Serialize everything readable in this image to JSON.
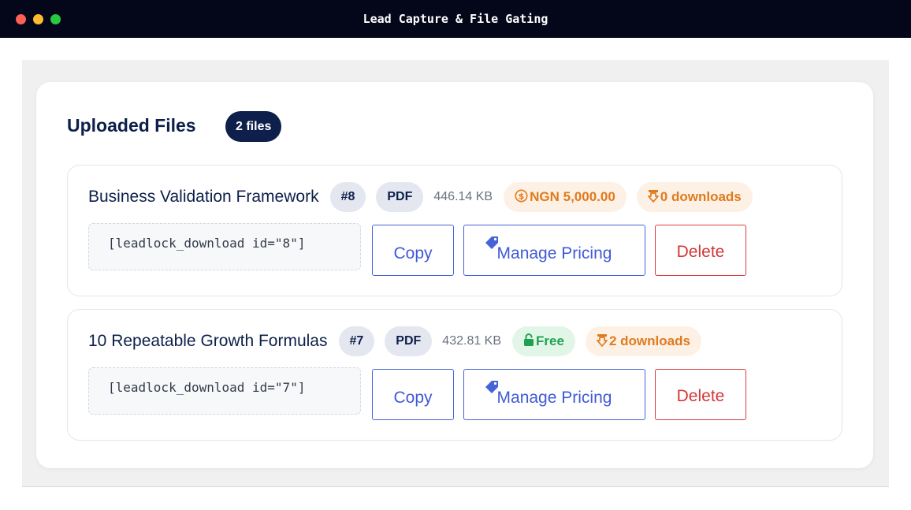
{
  "window": {
    "title": "Lead Capture & File Gating"
  },
  "panel": {
    "title": "Uploaded Files",
    "count_badge": "2 files"
  },
  "files": [
    {
      "name": "Business Validation Framework",
      "id_badge": "#8",
      "type": "PDF",
      "size": "446.14 KB",
      "price": "NGN 5,000.00",
      "downloads": "0 downloads",
      "shortcode": "[leadlock_download id=\"8\"]"
    },
    {
      "name": "10 Repeatable Growth Formulas",
      "id_badge": "#7",
      "type": "PDF",
      "size": "432.81 KB",
      "price": "Free",
      "downloads": "2 downloads",
      "shortcode": "[leadlock_download id=\"7\"]"
    }
  ],
  "actions": {
    "copy": "Copy",
    "manage_pricing": "Manage Pricing",
    "delete": "Delete"
  },
  "icons": {
    "paid": "dollar-circle-icon",
    "free": "lock-icon",
    "downloads": "download-arrow-icon",
    "pricing": "tag-icon"
  },
  "colors": {
    "titlebar": "#04061a",
    "navy": "#0d1f4a",
    "primary": "#4763d9",
    "danger": "#d63e3e",
    "orange": "#e07a1e",
    "green": "#20a150"
  }
}
